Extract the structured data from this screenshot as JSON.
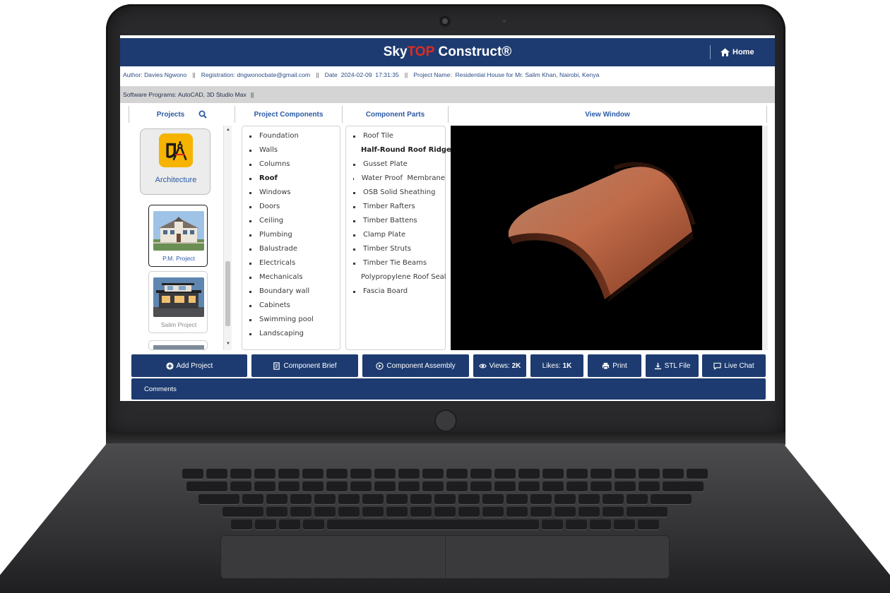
{
  "app": {
    "title_prefix": "Sky",
    "title_accent": "TOP",
    "title_suffix": " Construct®",
    "home_label": "Home"
  },
  "info": {
    "author": "Author: Davies Ngwono",
    "registration": "Registration: dngwonocbate@gmail.com",
    "date": "Date  2024-02-09  17:31:35",
    "project_name": "Project Name:  Residential House for Mr. Salim Khan, Nairobi, Kenya",
    "separator": "||",
    "software": "Software Programs: AutoCAD, 3D Studio Max"
  },
  "columns": {
    "projects": "Projects",
    "components": "Project Components",
    "parts": "Component Parts",
    "view": "View Window"
  },
  "projects": {
    "category": "Architecture",
    "items": [
      {
        "label": "P.M. Project",
        "active": true
      },
      {
        "label": "Salim Project",
        "active": false
      }
    ]
  },
  "components": [
    {
      "label": "Foundation",
      "bold": false
    },
    {
      "label": "Walls",
      "bold": false
    },
    {
      "label": "Columns",
      "bold": false
    },
    {
      "label": "Roof",
      "bold": true
    },
    {
      "label": "Windows",
      "bold": false
    },
    {
      "label": "Doors",
      "bold": false
    },
    {
      "label": "Ceiling",
      "bold": false
    },
    {
      "label": "Plumbing",
      "bold": false
    },
    {
      "label": "Balustrade",
      "bold": false
    },
    {
      "label": "Electricals",
      "bold": false
    },
    {
      "label": "Mechanicals",
      "bold": false
    },
    {
      "label": "Boundary wall",
      "bold": false
    },
    {
      "label": "Cabinets",
      "bold": false
    },
    {
      "label": "Swimming pool",
      "bold": false
    },
    {
      "label": "Landscaping",
      "bold": false
    }
  ],
  "parts": [
    {
      "label": "Roof Tile",
      "bold": false
    },
    {
      "label": "Half-Round Roof Ridge",
      "bold": true
    },
    {
      "label": "Gusset Plate",
      "bold": false
    },
    {
      "label": "Water Proof  Membrane",
      "bold": false
    },
    {
      "label": "OSB Solid Sheathing",
      "bold": false
    },
    {
      "label": "Timber Rafters",
      "bold": false
    },
    {
      "label": "Timber Battens",
      "bold": false
    },
    {
      "label": "Clamp Plate",
      "bold": false
    },
    {
      "label": "Timber Struts",
      "bold": false
    },
    {
      "label": "Timber Tie Beams",
      "bold": false
    },
    {
      "label": "Polypropylene Roof Seal",
      "bold": false
    },
    {
      "label": "Fascia Board",
      "bold": false
    }
  ],
  "toolbar": {
    "add_project": "Add Project",
    "component_brief": "Component Brief",
    "component_assembly": "Component Assembly",
    "views_label": "Views: ",
    "views_value": "2K",
    "likes_label": "Likes: ",
    "likes_value": "1K",
    "print": "Print",
    "stl_file": "STL File",
    "live_chat": "Live Chat"
  },
  "comments_label": "Comments",
  "colors": {
    "navy": "#1d3b70",
    "accent_red": "#e02b20",
    "link_blue": "#2b5aa6",
    "arch_yellow": "#f6b400",
    "tile_copper": "#c8704d"
  },
  "icons": {
    "home": "home-icon",
    "search": "search-icon",
    "add": "plus-circle-icon",
    "brief": "document-icon",
    "assembly": "play-circle-icon",
    "views": "eye-icon",
    "print": "printer-icon",
    "stl": "download-icon",
    "chat": "chat-bubble-icon",
    "architecture": "drafting-compass-icon"
  }
}
